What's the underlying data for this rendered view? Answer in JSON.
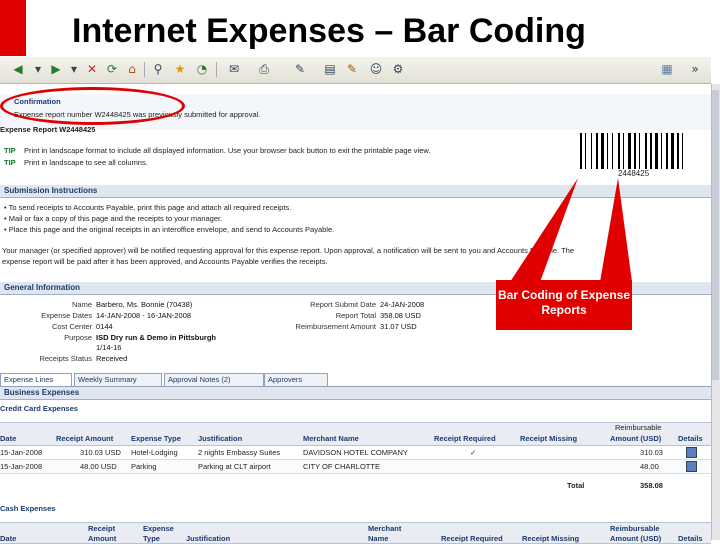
{
  "slide": {
    "title": "Internet Expenses – Bar Coding",
    "accent": "#e00000"
  },
  "toolbar": {
    "icons": [
      "back-icon",
      "forward-icon",
      "stop-icon",
      "refresh-icon",
      "home-icon",
      "search-icon",
      "favorites-icon",
      "history-icon",
      "mail-icon",
      "print-icon",
      "edit-icon",
      "discuss-icon",
      "messenger-icon",
      "tools-icon"
    ]
  },
  "confirmation": {
    "heading": "Confirmation",
    "message": "Expense report number W2448425 was previously submitted for approval."
  },
  "printable": {
    "heading": "Expense Report W2448425",
    "tip1_label": "TIP",
    "tip1": "Print in landscape format to include all displayed information. Use your browser back button to exit the printable page view.",
    "tip2_label": "TIP",
    "tip2": "Print in landscape to see all columns.",
    "barcode_number": "2448425"
  },
  "submission": {
    "heading": "Submission Instructions",
    "items": [
      "To send receipts to Accounts Payable, print this page and attach all required receipts.",
      "Mail or fax a copy of this page and the receipts to your manager.",
      "Place this page and the original receipts in an interoffice envelope, and send to Accounts Payable."
    ],
    "note1": "Your manager (or specified approver) will be notified requesting approval for this expense report. Upon approval, a notification will be sent to you and Accounts Payable. The",
    "note2": "expense report will be paid after it has been approved, and Accounts Payable verifies the receipts."
  },
  "general": {
    "heading": "General Information",
    "left": [
      {
        "label": "Name",
        "value": "Barbero, Ms. Bonnie (70438)"
      },
      {
        "label": "Expense Dates",
        "value": "14-JAN-2008 - 16-JAN-2008"
      },
      {
        "label": "Cost Center",
        "value": "0144"
      },
      {
        "label": "Purpose",
        "value": "ISD Dry run & Demo in Pittsburgh"
      },
      {
        "label": "",
        "value": "1/14-16"
      },
      {
        "label": "Receipts Status",
        "value": "Received"
      }
    ],
    "right": [
      {
        "label": "Report Submit Date",
        "value": "24-JAN-2008"
      },
      {
        "label": "Report Total",
        "value": "358.08 USD"
      },
      {
        "label": "Reimbursement Amount",
        "value": "31.07 USD"
      }
    ]
  },
  "tabs": [
    "Expense Lines",
    "Weekly Summary",
    "Approval Notes (2)",
    "Approvers"
  ],
  "business": {
    "heading": "Business Expenses",
    "credit_heading": "Credit Card Expenses",
    "reimb_header1": "Reimbursable",
    "reimb_header2": "Amount (USD)",
    "columns": [
      "Date",
      "Receipt Amount",
      "Expense Type",
      "Justification",
      "Merchant Name",
      "Receipt Required",
      "Receipt Missing",
      "",
      "Details"
    ],
    "rows": [
      [
        "15-Jan-2008",
        "310.03 USD",
        "Hotel-Lodging",
        "2 nights Embassy Suites",
        "DAVIDSON HOTEL COMPANY",
        "✓",
        "",
        "310.03",
        ""
      ],
      [
        "15-Jan-2008",
        "48.00 USD",
        "Parking",
        "Parking at CLT airport",
        "CITY OF CHARLOTTE",
        "",
        "",
        "48.00",
        ""
      ]
    ],
    "total_label": "Total",
    "total_value": "358.08"
  },
  "cash": {
    "heading": "Cash Expenses",
    "columns_top": [
      "",
      "Receipt",
      "Expense",
      "",
      "Merchant",
      "",
      "",
      "Reimbursable",
      ""
    ],
    "columns": [
      "Date",
      "Amount",
      "Type",
      "Justification",
      "Name",
      "Receipt Required",
      "Receipt Missing",
      "Amount (USD)",
      "Details"
    ]
  },
  "callout": {
    "text": "Bar Coding of Expense Reports"
  }
}
